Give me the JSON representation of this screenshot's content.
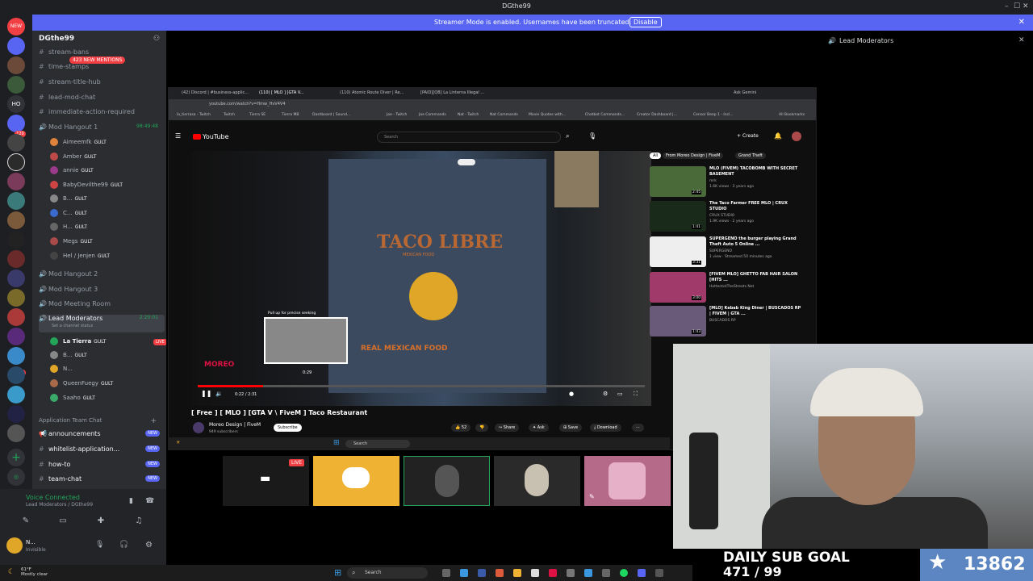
{
  "window": {
    "title": "DGthe99",
    "controls": [
      "–",
      "☐",
      "✕"
    ]
  },
  "banner": {
    "message": "Streamer Mode is enabled. Usernames have been truncated.",
    "button_label": "Disable",
    "close": "✕"
  },
  "rail": {
    "new_badge": "NEW",
    "ho_label": "HO",
    "badges": [
      "20",
      "120",
      "45",
      "500"
    ]
  },
  "server": {
    "name": "DGthe99",
    "mentions": "423 NEW MENTIONS"
  },
  "channels": [
    {
      "label": "stream-bans"
    },
    {
      "label": "time-stamps"
    },
    {
      "label": "stream-title-hub"
    },
    {
      "label": "lead-mod-chat"
    },
    {
      "label": "immediate-action-required"
    }
  ],
  "voice_channels": {
    "hangout1": {
      "label": "Mod Hangout 1",
      "timer": "98:49:48"
    },
    "hangout1_users": [
      {
        "name": "Aimeemfk",
        "tag": "GULT"
      },
      {
        "name": "Amber",
        "tag": "GULT"
      },
      {
        "name": "annie",
        "tag": "GULT"
      },
      {
        "name": "BabyDevilthe99",
        "tag": "GULT"
      },
      {
        "name": "B...",
        "tag": "GULT"
      },
      {
        "name": "C...",
        "tag": "GULT"
      },
      {
        "name": "H...",
        "tag": "GULT"
      },
      {
        "name": "Megs",
        "tag": "GULT"
      },
      {
        "name": "Hel / Jenjen",
        "tag": "GULT"
      }
    ],
    "hangout2": "Mod Hangout 2",
    "hangout3": "Mod Hangout 3",
    "meeting": "Mod Meeting Room",
    "lead": {
      "label": "Lead Moderators",
      "timer": "2:20:01",
      "status": "Set a channel status"
    },
    "lead_users": [
      {
        "name": "La Tierra",
        "tag": "GULT",
        "live": "LIVE"
      },
      {
        "name": "B...",
        "tag": "GULT"
      },
      {
        "name": "N...",
        "tag": ""
      },
      {
        "name": "QueenFuegy",
        "tag": "GULT"
      },
      {
        "name": "Saaho",
        "tag": "GULT"
      }
    ]
  },
  "category": {
    "label": "Application Team Chat",
    "channels": [
      {
        "label": "announcements",
        "badge": "NEW"
      },
      {
        "label": "whitelist-application...",
        "badge": "NEW"
      },
      {
        "label": "how-to",
        "badge": "NEW"
      },
      {
        "label": "team-chat",
        "badge": "NEW"
      }
    ]
  },
  "voice_panel": {
    "status": "Voice Connected",
    "location": "Lead Moderators / DGthe99",
    "username": "N...",
    "user_status": "Invisible"
  },
  "members": {
    "header": "Lead Moderators"
  },
  "browser": {
    "tabs": [
      "(42) Discord | #business-applic...",
      "(110) [ MLO ] [GTA V...",
      "(110) Atomic Route Diver | Re...",
      "[PAID][QB] La Linterna Illegal ..."
    ],
    "ask_gemini": "Ask Gemini",
    "url": "youtube.com/watch?v=Hmw_HvV4V4",
    "bookmarks": [
      "la_tierrasa - Twitch",
      "Twitch",
      "Tierra SE",
      "Tierra MB",
      "Dashboard | Sound...",
      "Joe - Twitch",
      "Joe Commands",
      "Nat - Twitch",
      "Nat Commands",
      "Movie Quotes with...",
      "Chatbot Commands...",
      "Creator Dashboard |...",
      "Censor Beep 1 - Incl...",
      "All Bookmarks"
    ]
  },
  "youtube": {
    "logo": "YouTube",
    "search_placeholder": "Search",
    "create": "Create",
    "video_title": "[ Free ] [ MLO ] [GTA V \\ FiveM ] Taco Restaurant",
    "channel": "Moreo Design | FiveM",
    "subscribers": "949 subscribers",
    "subscribe": "Subscribe",
    "likes": "52",
    "ask": "Ask",
    "share": "Share",
    "save": "Save",
    "download": "Download",
    "scrub_tip": "Pull up for precise seeking",
    "scrub_time": "0:29",
    "time": "0:22 / 2:31",
    "sign_text": "TACO LIBRE",
    "sign_sub": "MEXICAN FOOD",
    "foot_text": "REAL MEXICAN FOOD",
    "watermark": "MOREO",
    "chips": [
      "All",
      "From Moreo Design | FiveM",
      "Grand Theft"
    ],
    "progress": 0.146,
    "recommendations": [
      {
        "title": "MLO (FIVEM) TACOBOMB WITH SECRET BASEMENT",
        "channel": "mrk",
        "meta": "1.6K views · 3 years ago",
        "duration": "2:45"
      },
      {
        "title": "The Taco Farmer FREE MLO | CRUX STUDIO",
        "channel": "CRUX STUDIO",
        "meta": "1.9K views · 2 years ago",
        "duration": "1:41"
      },
      {
        "title": "SUPERGENO the burger playing Grand Theft Auto 5 Online ...",
        "channel": "SUPERGENO",
        "meta": "1 view · Streamed 50 minutes ago",
        "duration": "3:31"
      },
      {
        "title": "[FIVEM MLO] GHETTO FAB HAIR SALON [HITS ...",
        "channel": "HottentotTheStreets Net",
        "meta": "",
        "duration": "3:00"
      },
      {
        "title": "[MLO] Kebab King Diner | BUSCADOS RP | FIVEM | GTA ...",
        "channel": "BUSCADOS RP",
        "meta": "",
        "duration": "1:43"
      }
    ]
  },
  "inner_taskbar": {
    "search": "Search"
  },
  "tiles": {
    "live": "LIVE"
  },
  "sub_goal": {
    "line1": "DAILY SUB GOAL",
    "line2": "471 / 99",
    "count": "13862"
  },
  "taskbar": {
    "weather_temp": "61°F",
    "weather_desc": "Mostly clear",
    "search": "Search"
  }
}
